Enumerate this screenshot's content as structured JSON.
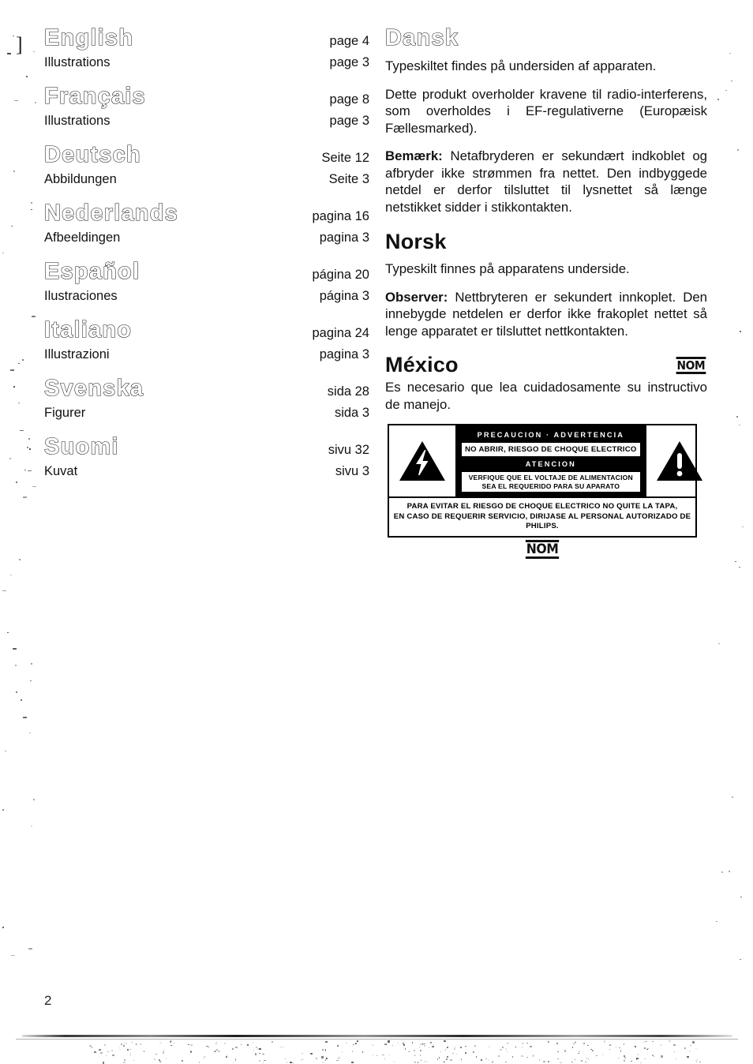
{
  "page": {
    "number": "2"
  },
  "languages": [
    {
      "name": "English",
      "ref": "page 4",
      "sub_label": "Illustrations",
      "sub_ref": "page 3"
    },
    {
      "name": "Français",
      "ref": "page 8",
      "sub_label": "Illustrations",
      "sub_ref": "page 3"
    },
    {
      "name": "Deutsch",
      "ref": "Seite 12",
      "sub_label": "Abbildungen",
      "sub_ref": "Seite 3"
    },
    {
      "name": "Nederlands",
      "ref": "pagina 16",
      "sub_label": "Afbeeldingen",
      "sub_ref": "pagina 3"
    },
    {
      "name": "Español",
      "ref": "página 20",
      "sub_label": "Ilustraciones",
      "sub_ref": "página 3"
    },
    {
      "name": "Italiano",
      "ref": "pagina 24",
      "sub_label": "Illustrazioni",
      "sub_ref": "pagina 3"
    },
    {
      "name": "Svenska",
      "ref": "sida 28",
      "sub_label": "Figurer",
      "sub_ref": "sida 3"
    },
    {
      "name": "Suomi",
      "ref": "sivu 32",
      "sub_label": "Kuvat",
      "sub_ref": "sivu 3"
    }
  ],
  "dansk": {
    "heading": "Dansk",
    "p1": "Typeskiltet findes på undersiden af apparaten.",
    "p2": "Dette produkt overholder kravene til radio-interferens, som overholdes i EF-regulativerne (Europæisk Fællesmarked).",
    "p3_lead": "Bemærk:",
    "p3": " Netafbryderen er sekundært indkoblet og afbryder ikke strømmen fra nettet. Den indbyggede netdel er derfor tilsluttet til lysnettet så længe netstikket sidder i stikkontakten."
  },
  "norsk": {
    "heading": "Norsk",
    "p1": "Typeskilt finnes på apparatens underside.",
    "p2_lead": "Observer:",
    "p2": " Nettbryteren er sekundert innkoplet. Den innebygde netdelen er derfor ikke frakoplet nettet så lenge apparatet er tilsluttet nettkontakten."
  },
  "mexico": {
    "heading": "México",
    "nom_mark": "NOM",
    "p1": "Es necesario que lea cuidadosamente su instructivo de manejo."
  },
  "warning_label": {
    "title_line": "PRECAUCION  ·  ADVERTENCIA",
    "line_no_open": "NO ABRIR, RIESGO DE CHOQUE ELECTRICO",
    "line_atencion": "ATENCION",
    "line_voltage_1": "VERFIQUE QUE EL VOLTAJE DE ALIMENTACION",
    "line_voltage_2": "SEA EL REQUERIDO PARA SU APARATO",
    "bottom_line_1": "PARA EVITAR EL RIESGO DE CHOQUE ELECTRICO NO QUITE LA TAPA,",
    "bottom_line_2": "EN CASO DE REQUERIR SERVICIO, DIRIJASE AL PERSONAL AUTORIZADO DE PHILIPS.",
    "left_icon": "lightning-bolt-triangle-icon",
    "right_icon": "exclamation-triangle-icon",
    "nom_mark": "NOM"
  },
  "artifacts": {
    "margin_bracket": "]"
  }
}
